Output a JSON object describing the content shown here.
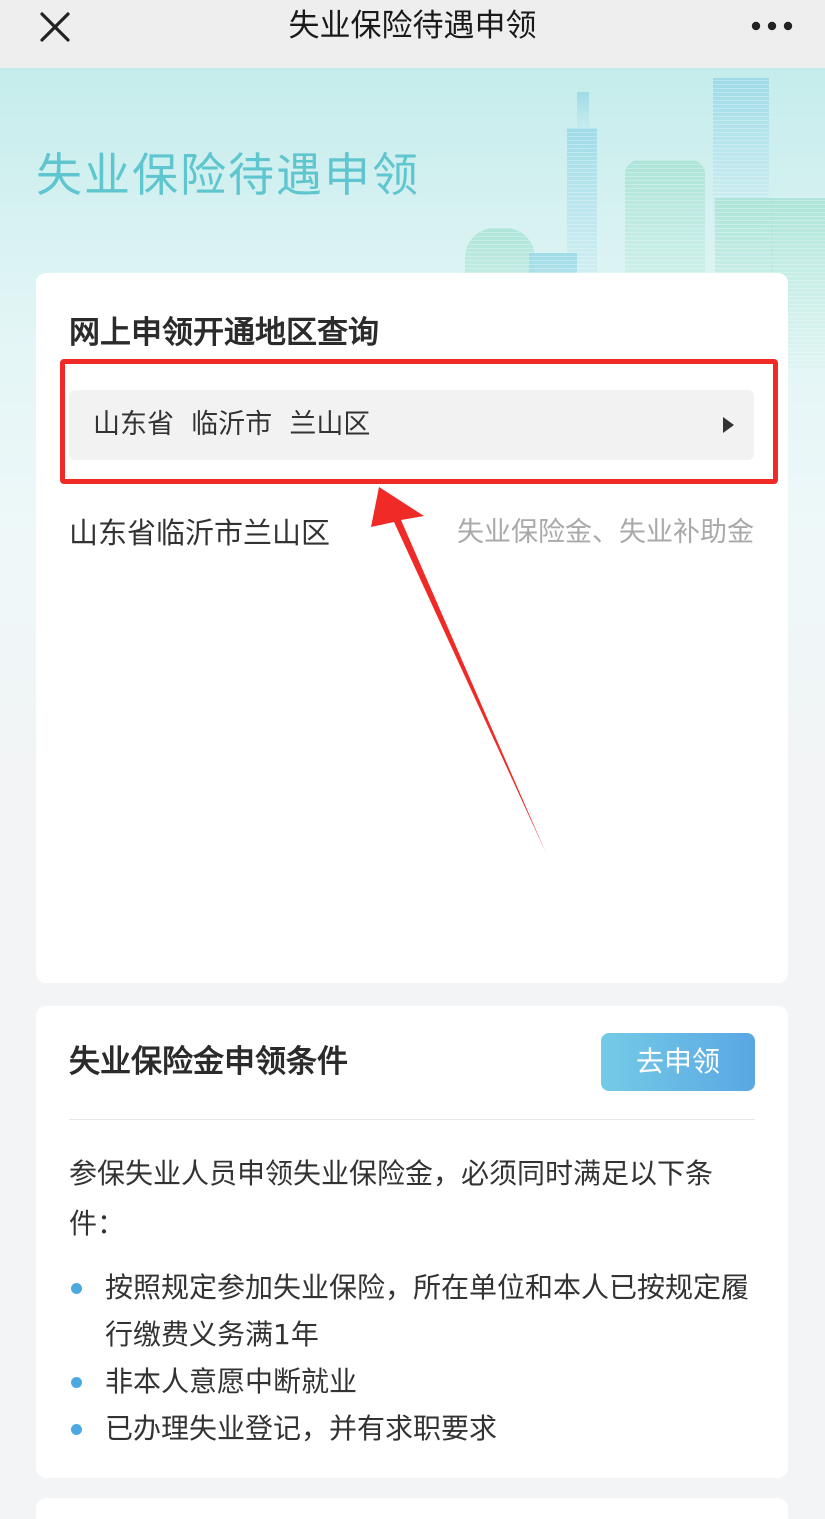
{
  "topbar": {
    "title": "失业保险待遇申领",
    "close_icon": "close-icon",
    "more_icon": "more-dots-icon"
  },
  "hero": {
    "title": "失业保险待遇申领"
  },
  "region_card": {
    "heading": "网上申领开通地区查询",
    "select_value": "山东省  临沂市  兰山区",
    "result_region": "山东省临沂市兰山区",
    "result_benefits": "失业保险金、失业补助金"
  },
  "conditions_card": {
    "heading": "失业保险金申领条件",
    "apply_button": "去申领",
    "intro": "参保失业人员申领失业保险金，必须同时满足以下条件：",
    "items": [
      "按照规定参加失业保险，所在单位和本人已按规定履行缴费义务满1年",
      "非本人意愿中断就业",
      "已办理失业登记，并有求职要求"
    ]
  },
  "colors": {
    "hero_title": "#5fc6cf",
    "highlight": "#f02a26",
    "button_start": "#74cbe6",
    "button_end": "#5aa7e3",
    "bullet": "#4ba9e0"
  }
}
